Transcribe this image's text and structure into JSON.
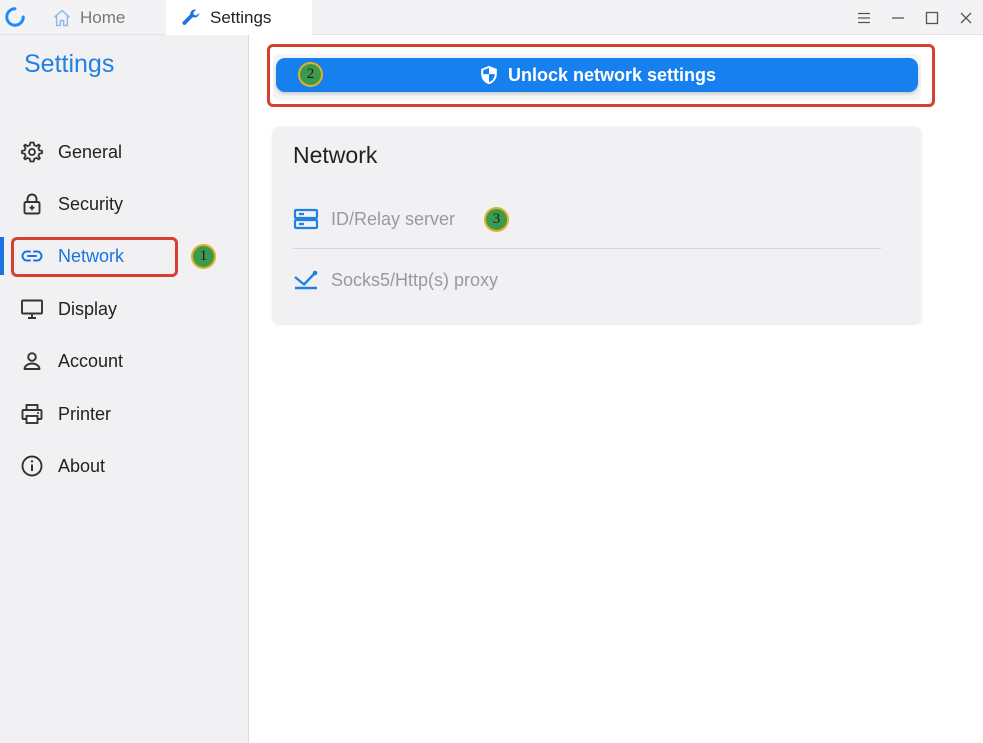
{
  "titlebar": {
    "tabs": [
      {
        "label": "Home",
        "icon": "home-icon"
      },
      {
        "label": "Settings",
        "icon": "wrench-icon"
      }
    ],
    "controls": [
      "menu-icon",
      "minimize-icon",
      "maximize-icon",
      "close-icon"
    ]
  },
  "sidebar": {
    "title": "Settings",
    "active": "Network",
    "items": [
      {
        "label": "General",
        "icon": "gear-icon"
      },
      {
        "label": "Security",
        "icon": "lock-icon"
      },
      {
        "label": "Network",
        "icon": "link-icon"
      },
      {
        "label": "Display",
        "icon": "monitor-icon"
      },
      {
        "label": "Account",
        "icon": "person-icon"
      },
      {
        "label": "Printer",
        "icon": "printer-icon"
      },
      {
        "label": "About",
        "icon": "info-icon"
      }
    ]
  },
  "main": {
    "unlock_label": "Unlock network settings",
    "card_title": "Network",
    "rows": [
      {
        "label": "ID/Relay server",
        "icon": "server-icon"
      },
      {
        "label": "Socks5/Http(s) proxy",
        "icon": "proxy-icon"
      }
    ]
  },
  "annotations": [
    "1",
    "2",
    "3"
  ],
  "colors": {
    "accent": "#1a74e0",
    "button": "#1680ef",
    "annotation_box": "#d6402f",
    "badge_fill": "#3c9a4f",
    "badge_ring": "#e2b12a"
  }
}
